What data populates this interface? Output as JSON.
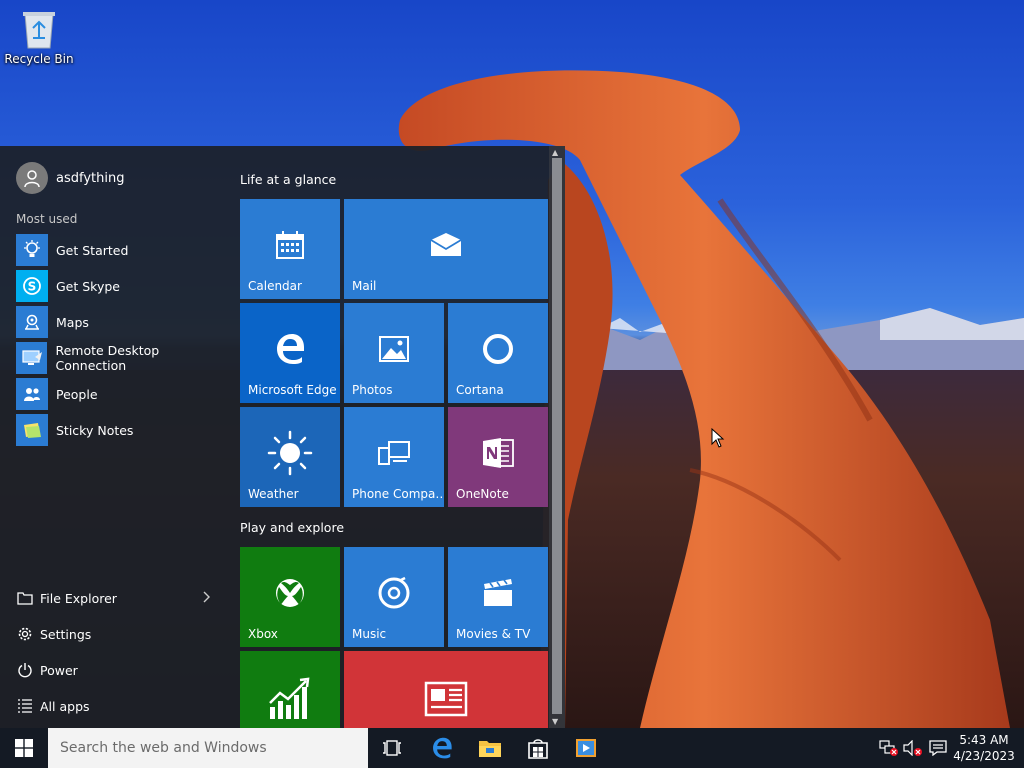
{
  "desktop": {
    "recycle_bin_label": "Recycle Bin"
  },
  "start_menu": {
    "user_name": "asdfything",
    "most_used_label": "Most used",
    "apps": [
      {
        "label": "Get Started",
        "icon": "lightbulb-icon"
      },
      {
        "label": "Get Skype",
        "icon": "skype-icon"
      },
      {
        "label": "Maps",
        "icon": "maps-icon"
      },
      {
        "label": "Remote Desktop Connection",
        "icon": "remote-desktop-icon"
      },
      {
        "label": "People",
        "icon": "people-icon"
      },
      {
        "label": "Sticky Notes",
        "icon": "sticky-notes-icon"
      }
    ],
    "bottom": [
      {
        "label": "File Explorer",
        "icon": "folder-icon"
      },
      {
        "label": "Settings",
        "icon": "gear-icon"
      },
      {
        "label": "Power",
        "icon": "power-icon"
      },
      {
        "label": "All apps",
        "icon": "list-icon"
      }
    ],
    "groups": {
      "life": "Life at a glance",
      "play": "Play and explore"
    },
    "tiles": {
      "calendar": "Calendar",
      "mail": "Mail",
      "edge": "Microsoft Edge",
      "photos": "Photos",
      "cortana": "Cortana",
      "weather": "Weather",
      "phone": "Phone Compa…",
      "onenote": "OneNote",
      "xbox": "Xbox",
      "music": "Music",
      "movies": "Movies & TV"
    }
  },
  "colors": {
    "tile_blue": "#2b7cd3",
    "tile_edge": "#0a64c8",
    "tile_weather": "#1c66b8",
    "tile_onenote": "#80397b",
    "tile_green": "#107c10",
    "tile_news": "#d13438"
  },
  "taskbar": {
    "search_placeholder": "Search the web and Windows",
    "time": "5:43 AM",
    "date": "4/23/2023"
  }
}
